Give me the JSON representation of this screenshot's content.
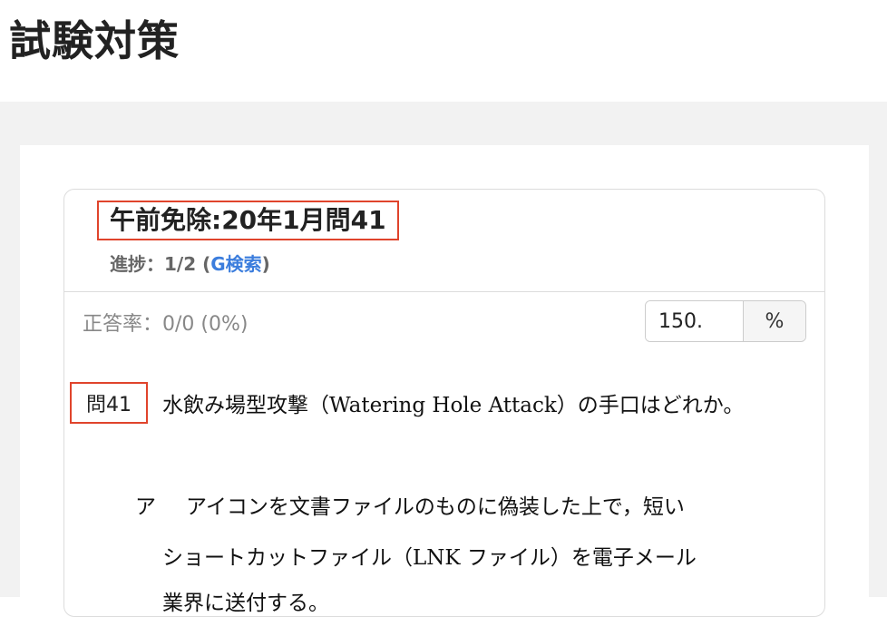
{
  "page": {
    "title": "試験対策"
  },
  "card": {
    "exam_title": "午前免除:20年1月問41",
    "progress_prefix": "進捗：1/2 (",
    "g_search": "G検索",
    "progress_suffix": ")",
    "rate": "正答率：0/0 (0%)",
    "zoom": {
      "value": "150.",
      "unit": "%"
    }
  },
  "question": {
    "number": "問41",
    "text": "水飲み場型攻撃（Watering Hole Attack）の手口はどれか。",
    "choices": [
      {
        "label": "ア",
        "line1": "アイコンを文書ファイルのものに偽装した上で，短い",
        "line2": "ショートカットファイル（LNK ファイル）を電子メール",
        "line3": "業界に送付する。"
      }
    ]
  }
}
